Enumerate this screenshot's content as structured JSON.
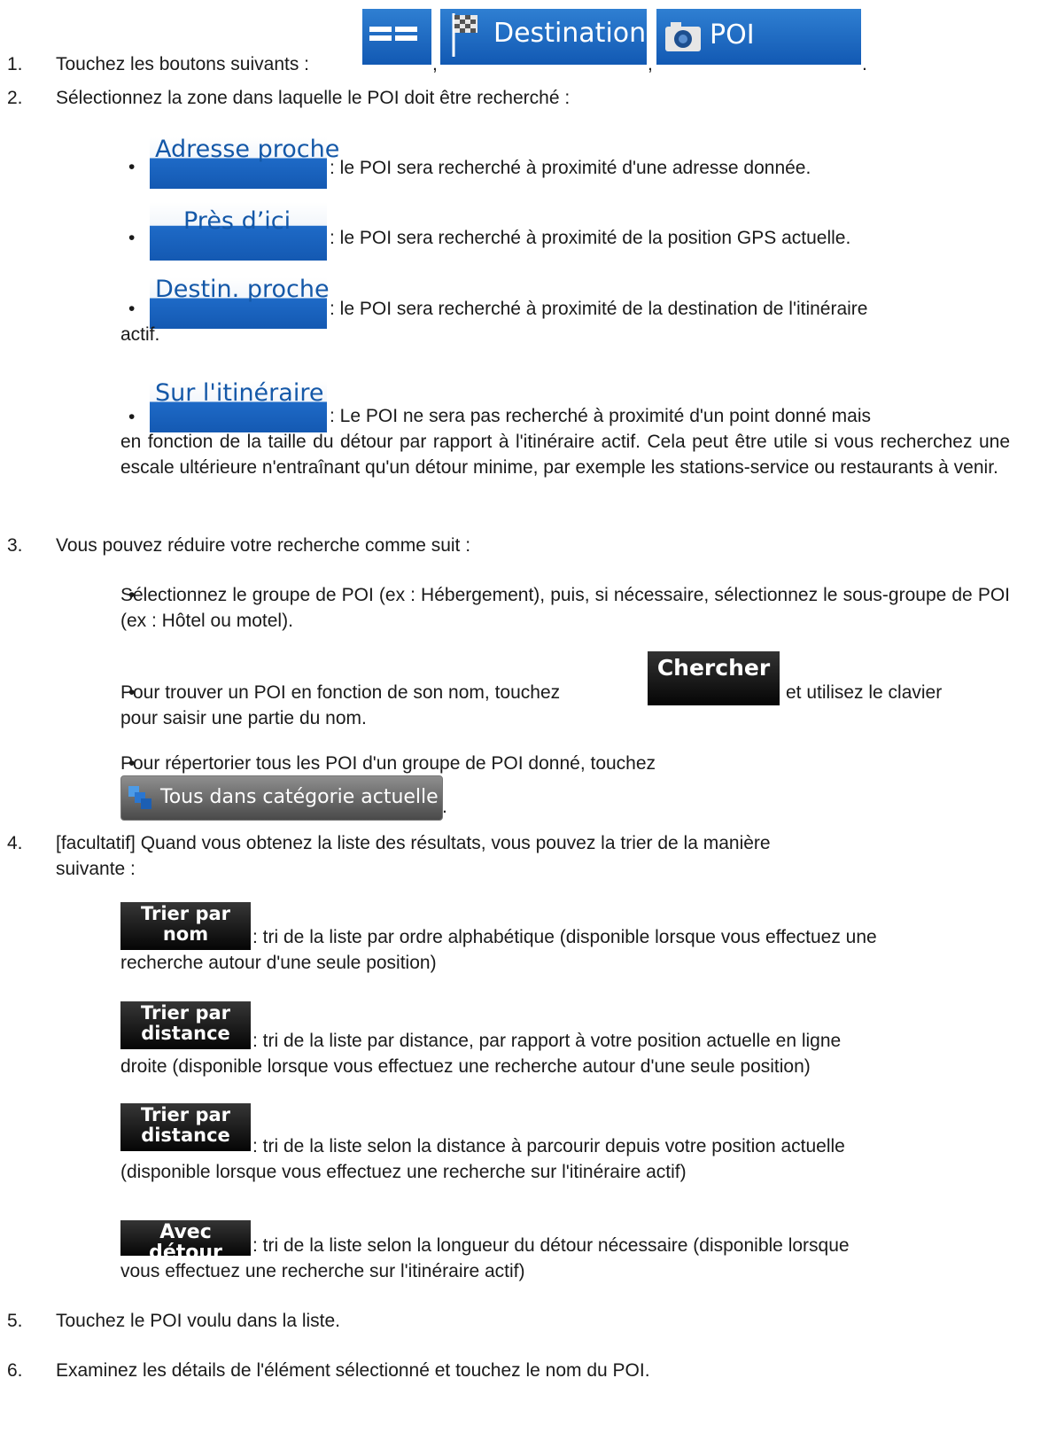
{
  "step1": {
    "number": "1.",
    "text": "Touchez les boutons suivants :",
    "sep1": ",",
    "sep2": ",",
    "end": ".",
    "buttons": [
      {
        "icon": "menu-icon",
        "label": ""
      },
      {
        "icon": "checkered-flag-icon",
        "label": "Destination"
      },
      {
        "icon": "camera-icon",
        "label": "POI"
      }
    ]
  },
  "step2": {
    "number": "2.",
    "text": "Sélectionnez la zone dans laquelle le POI doit être recherché :",
    "options": [
      {
        "button": "Adresse proche",
        "desc": ": le POI sera recherché à proximité d'une adresse donnée."
      },
      {
        "button": "Près d’ici",
        "desc": ": le POI sera recherché à proximité de la position GPS actuelle."
      },
      {
        "button": "Destin. proche",
        "desc": ": le POI sera recherché à proximité de la destination de l'itinéraire",
        "desc2": "actif."
      },
      {
        "button": "Sur l'itinéraire",
        "desc": ": Le POI ne sera pas recherché à proximité d'un point donné mais",
        "desc2": "en fonction de la taille du détour par rapport à l'itinéraire actif. Cela peut être utile si vous recherchez une escale ultérieure n'entraînant qu'un détour minime, par exemple les stations-service ou restaurants à venir."
      }
    ]
  },
  "step3": {
    "number": "3.",
    "text": "Vous pouvez réduire votre recherche comme suit :",
    "bullet1": "Sélectionnez le groupe de POI (ex : Hébergement), puis, si nécessaire, sélectionnez le sous-groupe de POI (ex : Hôtel ou motel).",
    "bullet2_pre": "Pour trouver un POI en fonction de son nom, touchez",
    "bullet2_button": "Chercher",
    "bullet2_post": "et utilisez le clavier",
    "bullet2_line2": "pour saisir une partie du nom.",
    "bullet3": "Pour répertorier tous les POI d'un groupe de POI donné, touchez",
    "bullet3_button": "Tous dans catégorie actuelle",
    "bullet3_end": "."
  },
  "step4": {
    "number": "4.",
    "text": "[facultatif] Quand vous obtenez la liste des résultats, vous pouvez la trier de la manière",
    "text2": "suivante :",
    "sorts": [
      {
        "line1": "Trier par",
        "line2": "nom",
        "desc": ": tri de la liste par ordre alphabétique (disponible lorsque vous effectuez une",
        "desc2": "recherche autour d'une seule position)"
      },
      {
        "line1": "Trier par",
        "line2": "distance",
        "desc": ": tri de la liste par distance, par rapport à votre position actuelle en ligne",
        "desc2": "droite (disponible lorsque vous effectuez une recherche autour d'une seule position)"
      },
      {
        "line1": "Trier par",
        "line2": "distance",
        "desc": ": tri de la liste selon la distance à parcourir depuis votre position actuelle",
        "desc2": "(disponible lorsque vous effectuez une recherche sur l'itinéraire actif)"
      },
      {
        "line1": "Avec détour",
        "line2": "",
        "desc": ": tri de la liste selon la longueur du détour nécessaire (disponible lorsque",
        "desc2": "vous effectuez une recherche sur l'itinéraire actif)"
      }
    ]
  },
  "step5": {
    "number": "5.",
    "text": "Touchez le POI voulu dans la liste."
  },
  "step6": {
    "number": "6.",
    "text": "Examinez les détails de l'élément sélectionné et touchez le nom du POI."
  }
}
